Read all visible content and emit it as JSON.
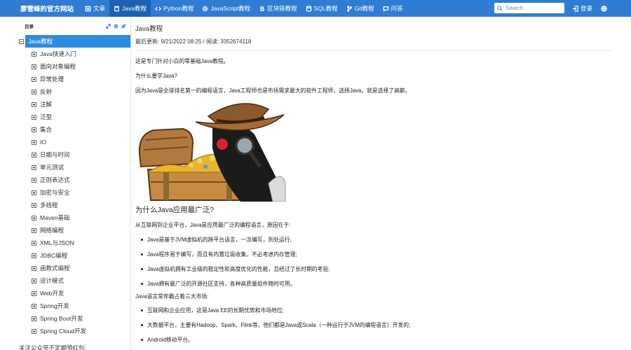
{
  "brand": "廖雪峰的官方网站",
  "nav": [
    {
      "label": "文章",
      "icon": "article-icon",
      "active": false
    },
    {
      "label": "Java教程",
      "icon": "book-icon",
      "active": true
    },
    {
      "label": "Python教程",
      "icon": "code-icon",
      "active": false
    },
    {
      "label": "JavaScript教程",
      "icon": "gear-icon",
      "active": false
    },
    {
      "label": "区块链教程",
      "icon": "bitcoin-icon",
      "active": false
    },
    {
      "label": "SQL教程",
      "icon": "database-icon",
      "active": false
    },
    {
      "label": "Git教程",
      "icon": "branch-icon",
      "active": false
    },
    {
      "label": "问答",
      "icon": "chat-icon",
      "active": false
    }
  ],
  "search": {
    "placeholder": "Search"
  },
  "login": {
    "label": "登录"
  },
  "toc": {
    "title": "目录",
    "root": "Java教程",
    "items": [
      "Java快速入门",
      "面向对象编程",
      "异常处理",
      "反射",
      "注解",
      "泛型",
      "集合",
      "IO",
      "日期与时间",
      "单元测试",
      "正则表达式",
      "加密与安全",
      "多线程",
      "Maven基础",
      "网络编程",
      "XML与JSON",
      "JDBC编程",
      "函数式编程",
      "设计模式",
      "Web开发",
      "Spring开发",
      "Spring Boot开发",
      "Spring Cloud开发"
    ],
    "follow": "关注公众号不定期领红包:"
  },
  "article": {
    "title": "Java教程",
    "meta": "最后更新: 9/21/2022 08:25 / 阅读: 3352674118",
    "p1": "这是专门针对小白的零基础Java教程。",
    "p2": "为什么要学Java?",
    "p3": "因为Java是全球排名第一的编程语言，Java工程师也是市场需求最大的软件工程师，选择Java，就是选择了高薪。",
    "h2": "为什么Java应用最广泛?",
    "p4": "从互联网到企业平台，Java是应用最广泛的编程语言，原因在于:",
    "bullets1": [
      "Java是基于JVM虚拟机的跨平台语言，一次编写，到处运行;",
      "Java程序易于编写，而且有内置垃圾收集，不必考虑内存管理;",
      "Java虚拟机拥有工业级的稳定性和高度优化的性能，且经过了长时期的考验;",
      "Java拥有最广泛的开源社区支持，各种高质量组件随时可用。"
    ],
    "p5": "Java语言常年霸占着三大市场:",
    "bullets2": [
      "互联网和企业应用，这是Java EE的长期优势和市场地位;",
      "大数据平台，主要有Hadoop、Spark、Flink等，他们都是Java或Scala（一种运行于JVM的编程语言）开发的;",
      "Android移动平台。"
    ]
  }
}
